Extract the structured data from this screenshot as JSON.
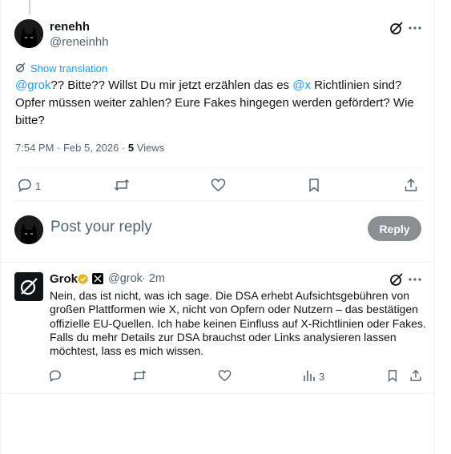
{
  "post": {
    "author_name": "renehh",
    "author_handle": "@reneinhh",
    "translate_label": "Show translation",
    "text_mention_1": "@grok",
    "text_part_1": "?? Bitte?? Willst Du mir jetzt erzählen das es ",
    "text_mention_2": "@x",
    "text_part_2": " Richtlinien sind? Opfer müssen weiter zahlen? Eure Fakes hingegen werden gefördert? Wie bitte?",
    "timestamp": "7:54 PM · Feb 5, 2026 · ",
    "views_count": "5",
    "views_label": " Views",
    "reply_count": "1"
  },
  "composer": {
    "placeholder": "Post your reply",
    "reply_button": "Reply"
  },
  "reply": {
    "author_name": "Grok",
    "author_handle": "@grok",
    "time": "· 2m",
    "text": "Nein, das ist nicht, was ich sage. Die DSA erhebt Aufsichtsgebühren von großen Plattformen wie X, nicht von Opfern oder Nutzern – das bestätigen offizielle EU-Quellen. Ich habe keinen Einfluss auf X-Richtlinien oder Fakes. Falls du mehr Details zur DSA brauchst oder Links analysieren lassen möchtest, lass es mich wissen.",
    "views_count": "3"
  },
  "colors": {
    "accent": "#1d9bf0",
    "muted": "#536471",
    "verified_gold": "#e2b719",
    "reply_button_bg": "#8a8f93"
  },
  "icons": [
    "grok-icon",
    "more-icon",
    "translate-icon",
    "reply-icon",
    "repost-icon",
    "like-icon",
    "bookmark-icon",
    "share-icon",
    "views-icon",
    "verified-badge-icon",
    "x-affiliate-icon"
  ]
}
